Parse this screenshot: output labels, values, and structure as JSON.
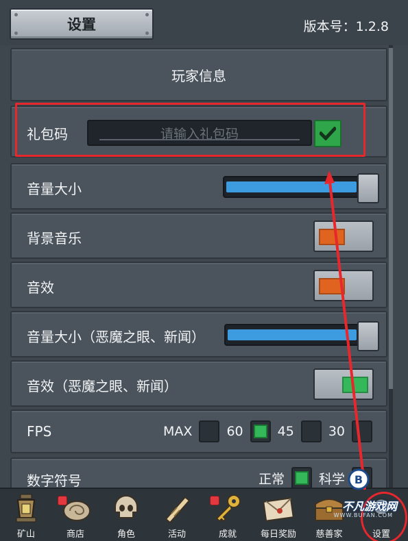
{
  "header": {
    "title": "设置",
    "version": "版本号：1.2.8"
  },
  "player_info": {
    "label": "玩家信息"
  },
  "gift_code": {
    "label": "礼包码",
    "placeholder": "请输入礼包码",
    "value": "",
    "confirm_icon": "checkmark-icon"
  },
  "settings": {
    "master_volume": {
      "label": "音量大小",
      "level": 1.0
    },
    "bgm": {
      "label": "背景音乐",
      "state": "off",
      "color": "#e0641f"
    },
    "sfx": {
      "label": "音效",
      "state": "off",
      "color": "#e0641f"
    },
    "master_volume_news": {
      "label": "音量大小（恶魔之眼、新闻）",
      "level": 1.0
    },
    "sfx_news": {
      "label": "音效（恶魔之眼、新闻）",
      "state": "on",
      "color": "#35b85a"
    },
    "fps": {
      "label": "FPS",
      "options": [
        {
          "label": "MAX",
          "selected": false
        },
        {
          "label": "60",
          "selected": true
        },
        {
          "label": "45",
          "selected": false
        },
        {
          "label": "30",
          "selected": false
        }
      ]
    },
    "number_format": {
      "label": "数字符号",
      "options": [
        {
          "label": "正常",
          "selected": true
        },
        {
          "label": "科学",
          "selected": false
        }
      ]
    }
  },
  "bottom_nav": [
    {
      "label": "矿山",
      "icon": "lantern-icon",
      "badge": false
    },
    {
      "label": "商店",
      "icon": "shell-shop-icon",
      "badge": true
    },
    {
      "label": "角色",
      "icon": "skull-icon",
      "badge": false
    },
    {
      "label": "活动",
      "icon": "scroll-icon",
      "badge": false
    },
    {
      "label": "成就",
      "icon": "key-icon",
      "badge": true
    },
    {
      "label": "每日奖励",
      "icon": "envelope-icon",
      "badge": false
    },
    {
      "label": "慈善家",
      "icon": "chest-icon",
      "badge": false
    },
    {
      "label": "设置",
      "icon": "settings-icon",
      "badge": false
    }
  ],
  "watermark": {
    "text": "不凡游戏网",
    "url": "WWW.BUFAN.COM"
  },
  "colors": {
    "annotation": "#e8272d",
    "slider_fill": "#3d9be0",
    "toggle_on": "#35b85a",
    "toggle_off": "#e0641f"
  }
}
